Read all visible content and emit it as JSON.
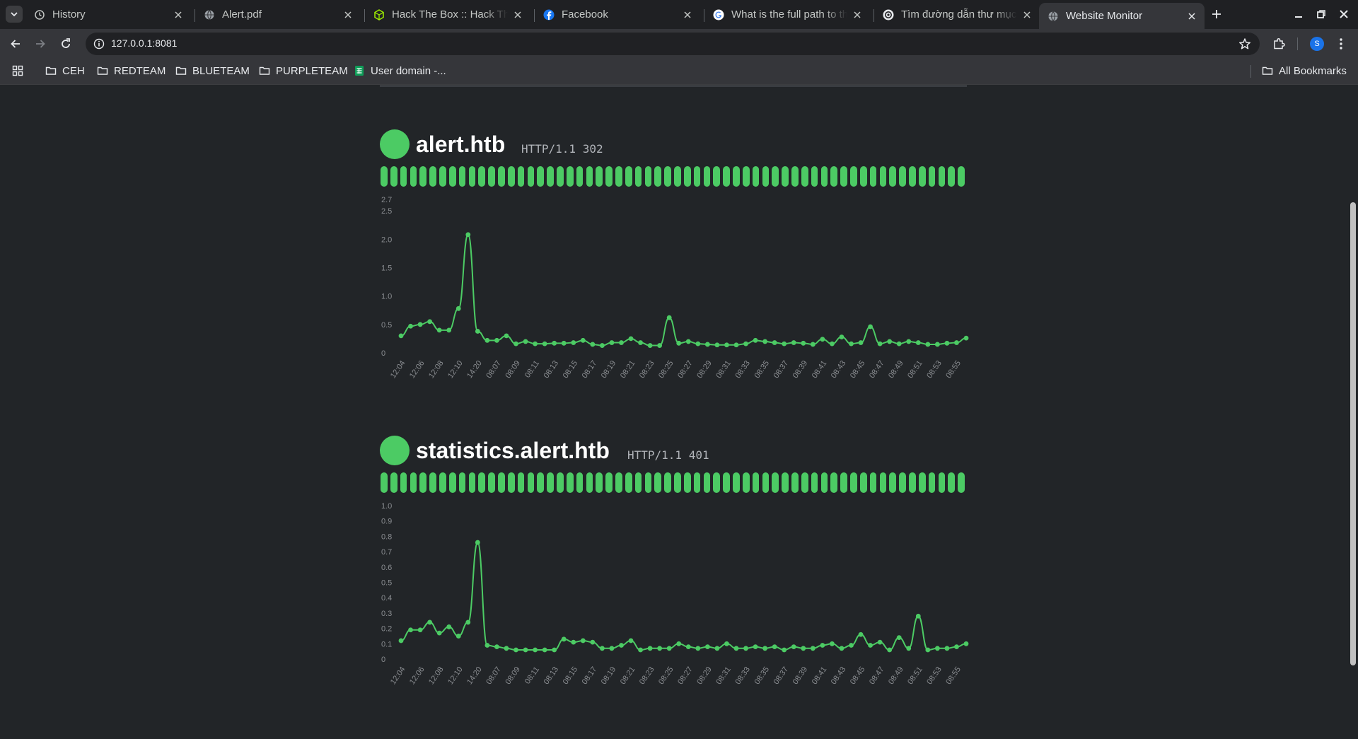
{
  "browser": {
    "tabs": [
      {
        "title": "History",
        "icon": "history-icon",
        "active": false
      },
      {
        "title": "Alert.pdf",
        "icon": "globe-icon",
        "active": false
      },
      {
        "title": "Hack The Box :: Hack The Box",
        "icon": "htb-cube-icon",
        "active": false
      },
      {
        "title": "Facebook",
        "icon": "facebook-icon",
        "active": false
      },
      {
        "title": "What is the full path to the",
        "icon": "google-icon",
        "active": false
      },
      {
        "title": "Tìm đường dẫn thư mục",
        "icon": "openai-icon",
        "active": false
      },
      {
        "title": "Website Monitor",
        "icon": "globe-icon",
        "active": true
      }
    ],
    "url": "127.0.0.1:8081",
    "profile_initial": "S",
    "bookmarks": [
      {
        "label": "CEH",
        "icon": "folder-icon"
      },
      {
        "label": "REDTEAM",
        "icon": "folder-icon"
      },
      {
        "label": "BLUETEAM",
        "icon": "folder-icon"
      },
      {
        "label": "PURPLETEAM",
        "icon": "folder-icon"
      },
      {
        "label": "User domain -...",
        "icon": "sheets-icon"
      }
    ],
    "all_bookmarks_label": "All Bookmarks"
  },
  "colors": {
    "status_up": "#4ccb64",
    "page_bg": "#222528",
    "chart_line": "#4ccb64"
  },
  "monitors": [
    {
      "host": "alert.htb",
      "protocol": "HTTP/1.1 302",
      "status": "up",
      "heartbeats": 60
    },
    {
      "host": "statistics.alert.htb",
      "protocol": "HTTP/1.1 401",
      "status": "up",
      "heartbeats": 60
    }
  ],
  "chart_data": [
    {
      "type": "line",
      "y_ticks": [
        "0",
        "0.5",
        "1.0",
        "1.5",
        "2.0",
        "2.5",
        "2.7"
      ],
      "ylim": [
        0,
        2.7
      ],
      "x_tick_labels": [
        "12:04",
        "12:06",
        "12:08",
        "12:10",
        "14:20",
        "08:07",
        "08:09",
        "08:11",
        "08:13",
        "08:15",
        "08:17",
        "08:19",
        "08:21",
        "08:23",
        "08:25",
        "08:27",
        "08:29",
        "08:31",
        "08:33",
        "08:35",
        "08:37",
        "08:39",
        "08:41",
        "08:43",
        "08:45",
        "08:47",
        "08:49",
        "08:51",
        "08:53",
        "08:55"
      ],
      "values": [
        0.3,
        0.47,
        0.5,
        0.55,
        0.4,
        0.4,
        0.78,
        2.08,
        0.38,
        0.22,
        0.22,
        0.3,
        0.16,
        0.2,
        0.16,
        0.16,
        0.17,
        0.17,
        0.18,
        0.22,
        0.15,
        0.13,
        0.18,
        0.18,
        0.25,
        0.18,
        0.13,
        0.13,
        0.62,
        0.17,
        0.2,
        0.16,
        0.15,
        0.14,
        0.14,
        0.14,
        0.16,
        0.22,
        0.2,
        0.18,
        0.16,
        0.18,
        0.17,
        0.15,
        0.24,
        0.16,
        0.28,
        0.16,
        0.18,
        0.46,
        0.16,
        0.2,
        0.16,
        0.2,
        0.18,
        0.15,
        0.15,
        0.17,
        0.18,
        0.26
      ],
      "grid": false
    },
    {
      "type": "line",
      "y_ticks": [
        "0",
        "0.1",
        "0.2",
        "0.3",
        "0.4",
        "0.5",
        "0.6",
        "0.7",
        "0.8",
        "0.9",
        "1.0"
      ],
      "ylim": [
        0,
        1.0
      ],
      "x_tick_labels": [
        "12:04",
        "12:06",
        "12:08",
        "12:10",
        "14:20",
        "08:07",
        "08:09",
        "08:11",
        "08:13",
        "08:15",
        "08:17",
        "08:19",
        "08:21",
        "08:23",
        "08:25",
        "08:27",
        "08:29",
        "08:31",
        "08:33",
        "08:35",
        "08:37",
        "08:39",
        "08:41",
        "08:43",
        "08:45",
        "08:47",
        "08:49",
        "08:51",
        "08:53",
        "08:55"
      ],
      "values": [
        0.12,
        0.19,
        0.19,
        0.24,
        0.17,
        0.21,
        0.15,
        0.24,
        0.76,
        0.09,
        0.08,
        0.07,
        0.06,
        0.06,
        0.06,
        0.06,
        0.06,
        0.13,
        0.11,
        0.12,
        0.11,
        0.07,
        0.07,
        0.09,
        0.12,
        0.06,
        0.07,
        0.07,
        0.07,
        0.1,
        0.08,
        0.07,
        0.08,
        0.07,
        0.1,
        0.07,
        0.07,
        0.08,
        0.07,
        0.08,
        0.06,
        0.08,
        0.07,
        0.07,
        0.09,
        0.1,
        0.07,
        0.09,
        0.16,
        0.09,
        0.11,
        0.06,
        0.14,
        0.07,
        0.28,
        0.06,
        0.07,
        0.07,
        0.08,
        0.1
      ],
      "grid": false
    }
  ]
}
